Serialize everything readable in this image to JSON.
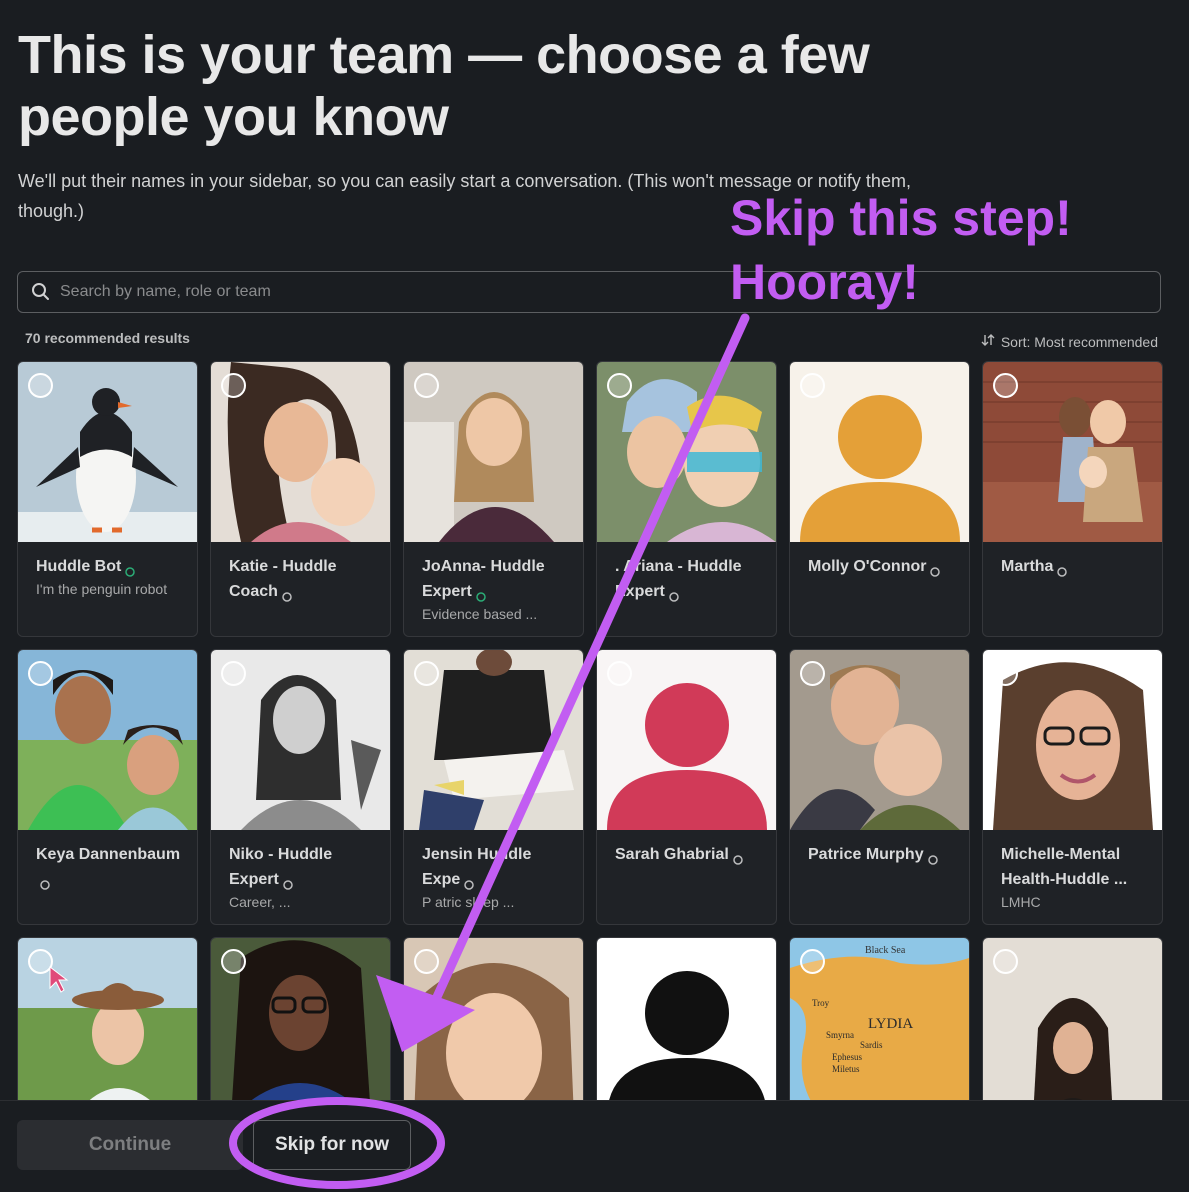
{
  "header": {
    "title": "This is your team — choose a few people you know",
    "subtitle": "We'll put their names in your sidebar, so you can easily start a conversation. (This won't message or notify them, though.)"
  },
  "search": {
    "placeholder": "Search by name, role or team",
    "value": ""
  },
  "results": {
    "count_label": "70 recommended results",
    "sort_label": "Sort: Most recommended"
  },
  "annotation": {
    "line1": "Skip this step!",
    "line2": "Hooray!",
    "color": "#c25df2"
  },
  "people": [
    {
      "name": "Huddle Bot",
      "sub": "I'm the penguin robot"
    },
    {
      "name": "Katie - Huddle Coach",
      "sub": ""
    },
    {
      "name": "JoAnna- Huddle Expert",
      "sub": "Evidence based ..."
    },
    {
      "name": ". Ariana - Huddle Expert",
      "sub": ""
    },
    {
      "name": "Molly O'Connor",
      "sub": ""
    },
    {
      "name": "Martha",
      "sub": ""
    },
    {
      "name": "Keya Dannenbaum",
      "sub": ""
    },
    {
      "name": "Niko - Huddle Expert",
      "sub": "Career, ..."
    },
    {
      "name": "Jensin Huddle Expe",
      "sub": "P atric sleep ..."
    },
    {
      "name": "Sarah Ghabrial",
      "sub": ""
    },
    {
      "name": "Patrice Murphy",
      "sub": ""
    },
    {
      "name": "Michelle-Mental Health-Huddle ...",
      "sub": "LMHC"
    }
  ],
  "map_labels": {
    "sea": "Black Sea",
    "region": "LYDIA",
    "cities": [
      "Troy",
      "Smyrna",
      "Sardis",
      "Ephesus",
      "Miletus"
    ]
  },
  "footer": {
    "continue_label": "Continue",
    "skip_label": "Skip for now"
  },
  "colors": {
    "accent": "#c25df2",
    "background": "#1a1d21"
  }
}
